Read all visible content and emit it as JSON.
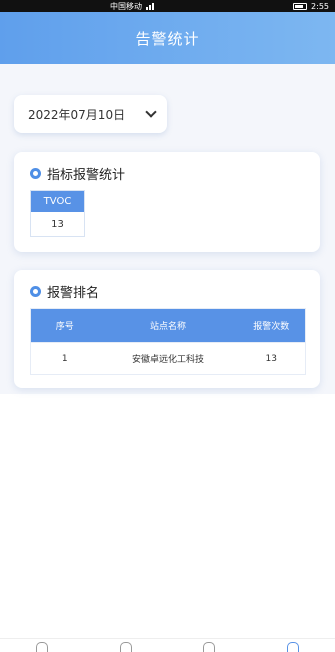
{
  "status_bar": {
    "carrier": "中国移动",
    "time": "2:55"
  },
  "header": {
    "title": "告警统计"
  },
  "date_selector": {
    "value": "2022年07月10日"
  },
  "indicator_card": {
    "title": "指标报警统计",
    "columns": [
      "TVOC"
    ],
    "values": [
      "13"
    ]
  },
  "ranking_card": {
    "title": "报警排名",
    "headers": [
      "序号",
      "站点名称",
      "报警次数"
    ],
    "rows": [
      [
        "1",
        "安徽卓远化工科技",
        "13"
      ]
    ]
  },
  "bottom_nav": {
    "items": [
      "home-icon",
      "calendar-icon",
      "chart-icon",
      "user-icon"
    ]
  }
}
